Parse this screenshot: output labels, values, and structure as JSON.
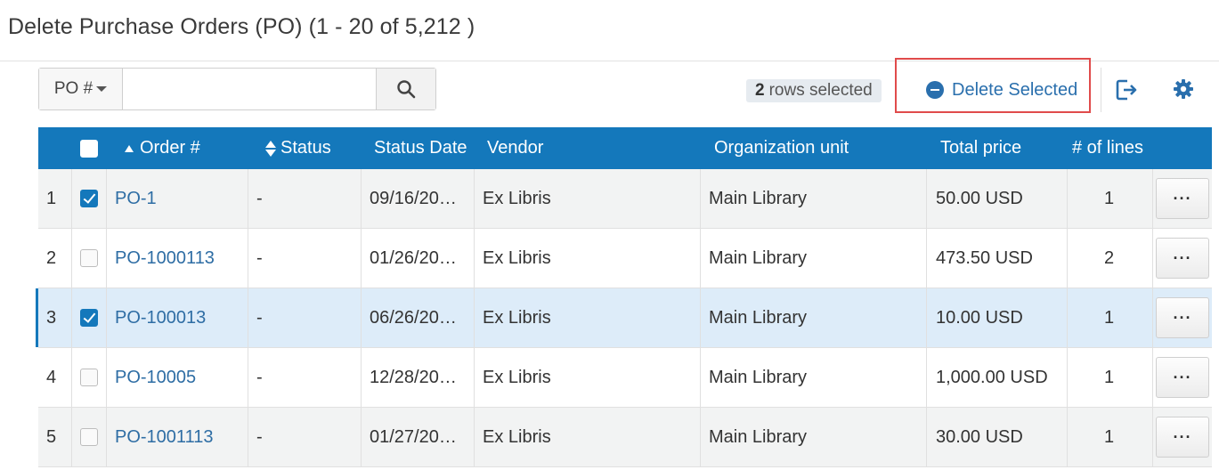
{
  "page": {
    "title": "Delete Purchase Orders (PO) (1 - 20 of 5,212 )"
  },
  "search": {
    "scope": "PO #",
    "value": "",
    "placeholder": ""
  },
  "toolbar": {
    "selected_count": "2",
    "selected_suffix": "rows selected",
    "delete_label": "Delete Selected"
  },
  "icons": {
    "search": "search-icon",
    "delete": "minus-circle-icon",
    "export": "export-icon",
    "settings": "gear-icon"
  },
  "colors": {
    "header_bg": "#1478bb",
    "link": "#2e6da4",
    "highlight_box": "#e04b4b",
    "selected_row": "#ddecf9"
  },
  "table": {
    "columns": {
      "order": "Order #",
      "status": "Status",
      "status_date": "Status Date",
      "vendor": "Vendor",
      "org_unit": "Organization unit",
      "total_price": "Total price",
      "lines": "# of lines"
    },
    "rows": [
      {
        "num": "1",
        "checked": true,
        "order": "PO-1",
        "status": "-",
        "status_date": "09/16/20…",
        "vendor": "Ex Libris",
        "org_unit": "Main Library",
        "total_price": "50.00 USD",
        "lines": "1",
        "more": "···"
      },
      {
        "num": "2",
        "checked": false,
        "order": "PO-1000113",
        "status": "-",
        "status_date": "01/26/20…",
        "vendor": "Ex Libris",
        "org_unit": "Main Library",
        "total_price": "473.50 USD",
        "lines": "2",
        "more": "···"
      },
      {
        "num": "3",
        "checked": true,
        "order": "PO-100013",
        "status": "-",
        "status_date": "06/26/20…",
        "vendor": "Ex Libris",
        "org_unit": "Main Library",
        "total_price": "10.00 USD",
        "lines": "1",
        "more": "···"
      },
      {
        "num": "4",
        "checked": false,
        "order": "PO-10005",
        "status": "-",
        "status_date": "12/28/20…",
        "vendor": "Ex Libris",
        "org_unit": "Main Library",
        "total_price": "1,000.00 USD",
        "lines": "1",
        "more": "···"
      },
      {
        "num": "5",
        "checked": false,
        "order": "PO-1001113",
        "status": "-",
        "status_date": "01/27/20…",
        "vendor": "Ex Libris",
        "org_unit": "Main Library",
        "total_price": "30.00 USD",
        "lines": "1",
        "more": "···"
      }
    ]
  }
}
